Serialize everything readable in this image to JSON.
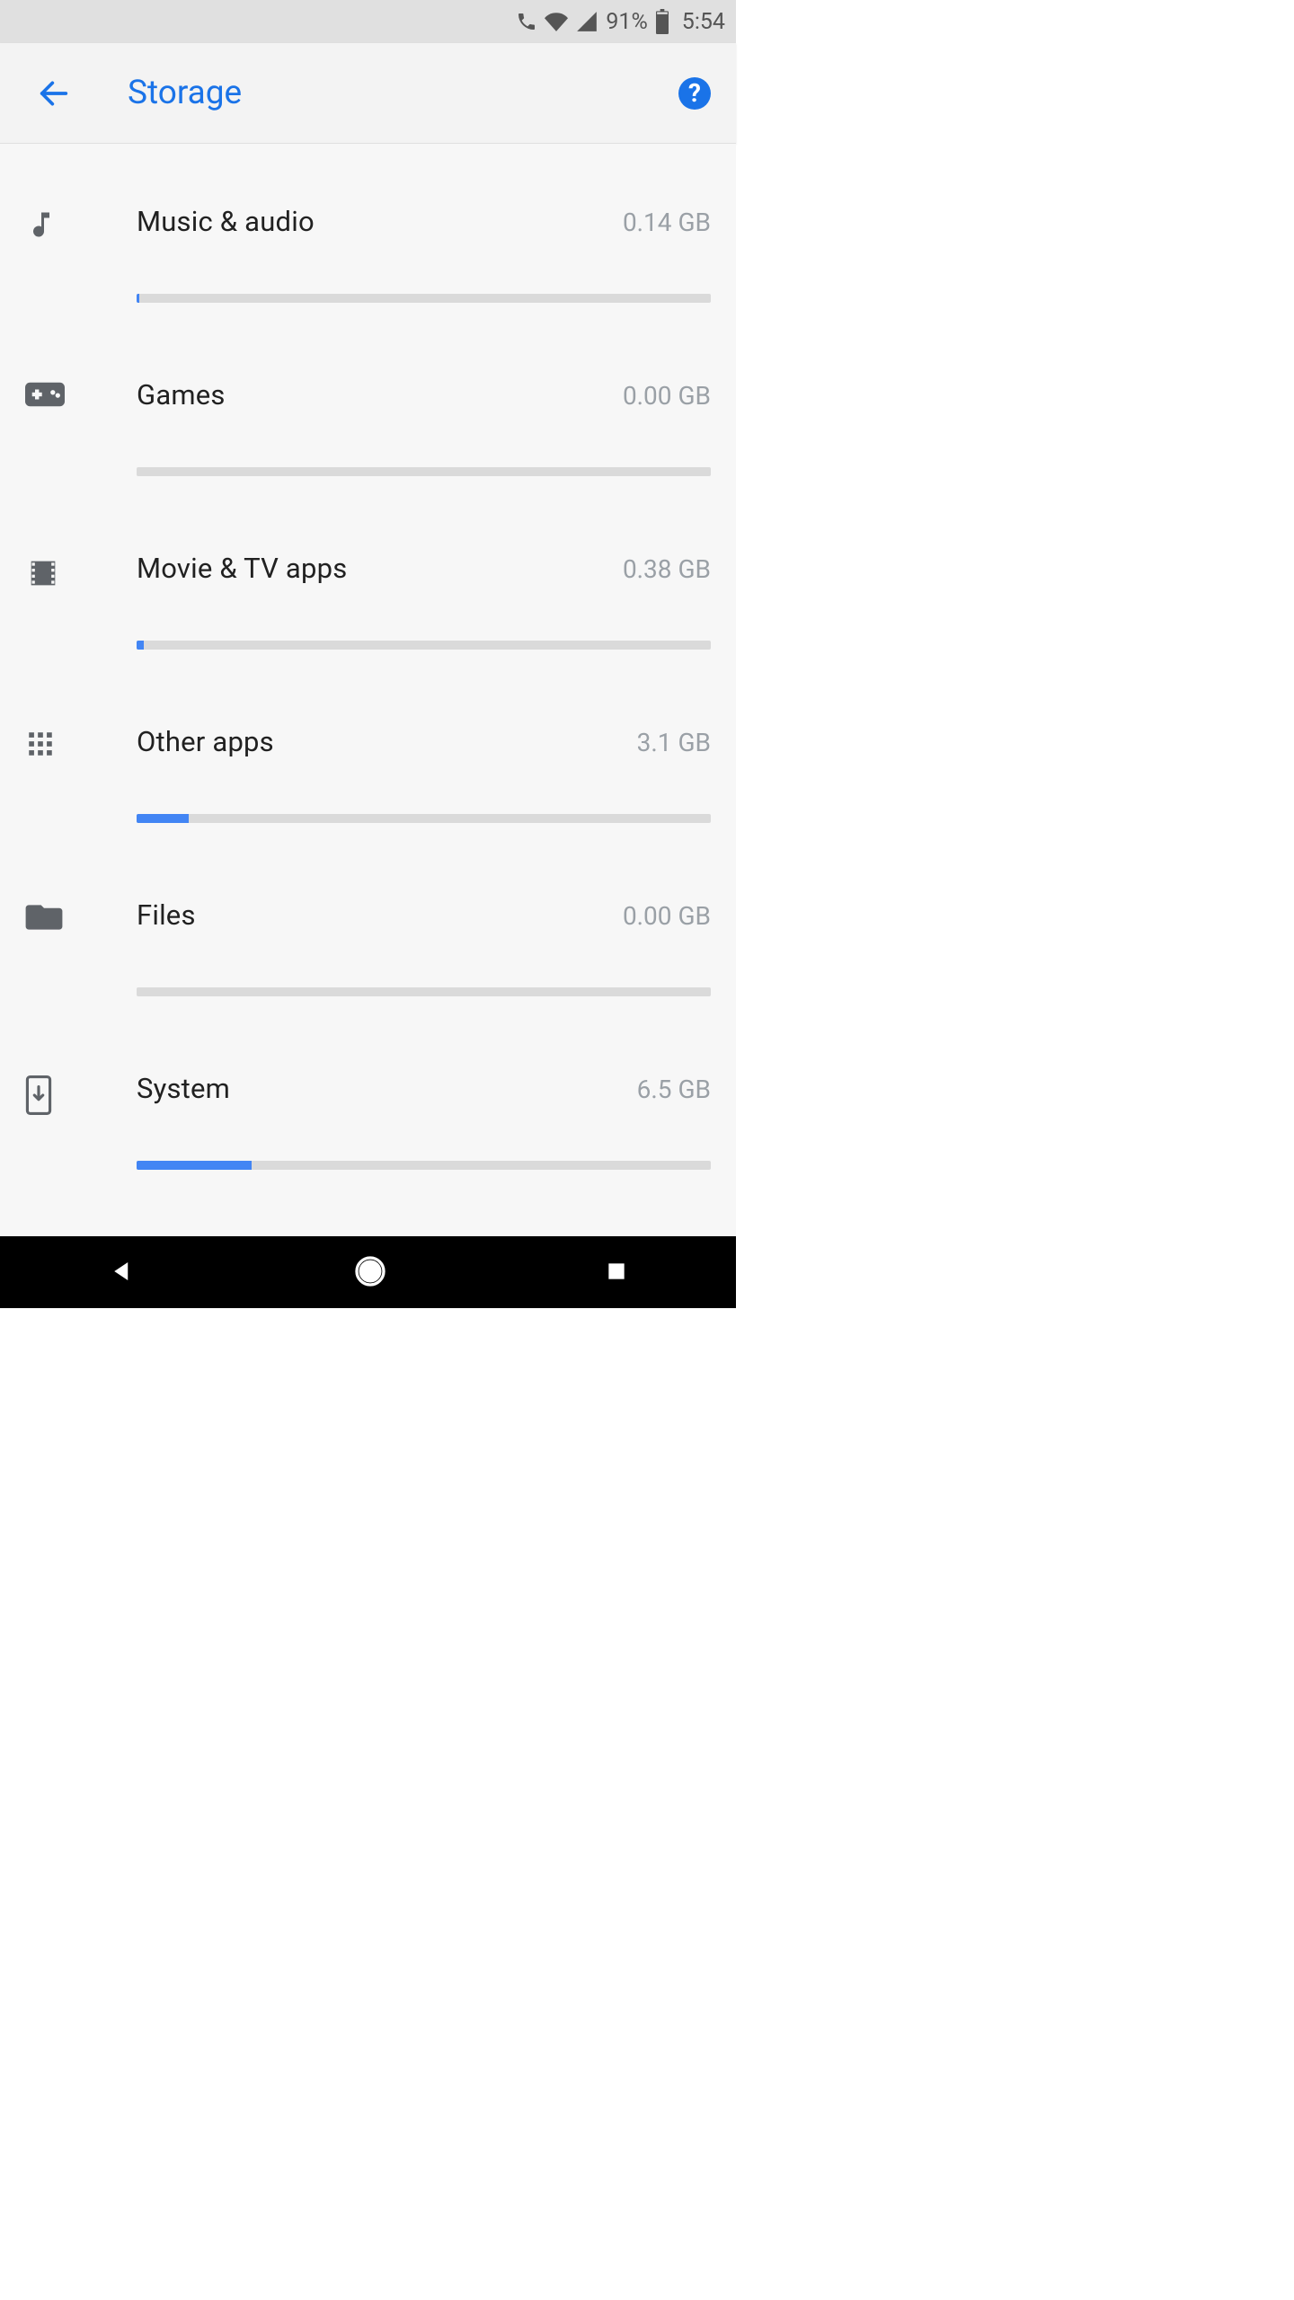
{
  "status": {
    "battery_pct": "91%",
    "time": "5:54"
  },
  "header": {
    "title": "Storage"
  },
  "list": [
    {
      "icon": "music",
      "label": "Music & audio",
      "value": "0.14 GB",
      "fill": 0.5
    },
    {
      "icon": "gamepad",
      "label": "Games",
      "value": "0.00 GB",
      "fill": 0
    },
    {
      "icon": "movie",
      "label": "Movie & TV apps",
      "value": "0.38 GB",
      "fill": 1.2
    },
    {
      "icon": "apps",
      "label": "Other apps",
      "value": "3.1 GB",
      "fill": 9
    },
    {
      "icon": "folder",
      "label": "Files",
      "value": "0.00 GB",
      "fill": 0
    },
    {
      "icon": "system",
      "label": "System",
      "value": "6.5 GB",
      "fill": 20
    }
  ]
}
